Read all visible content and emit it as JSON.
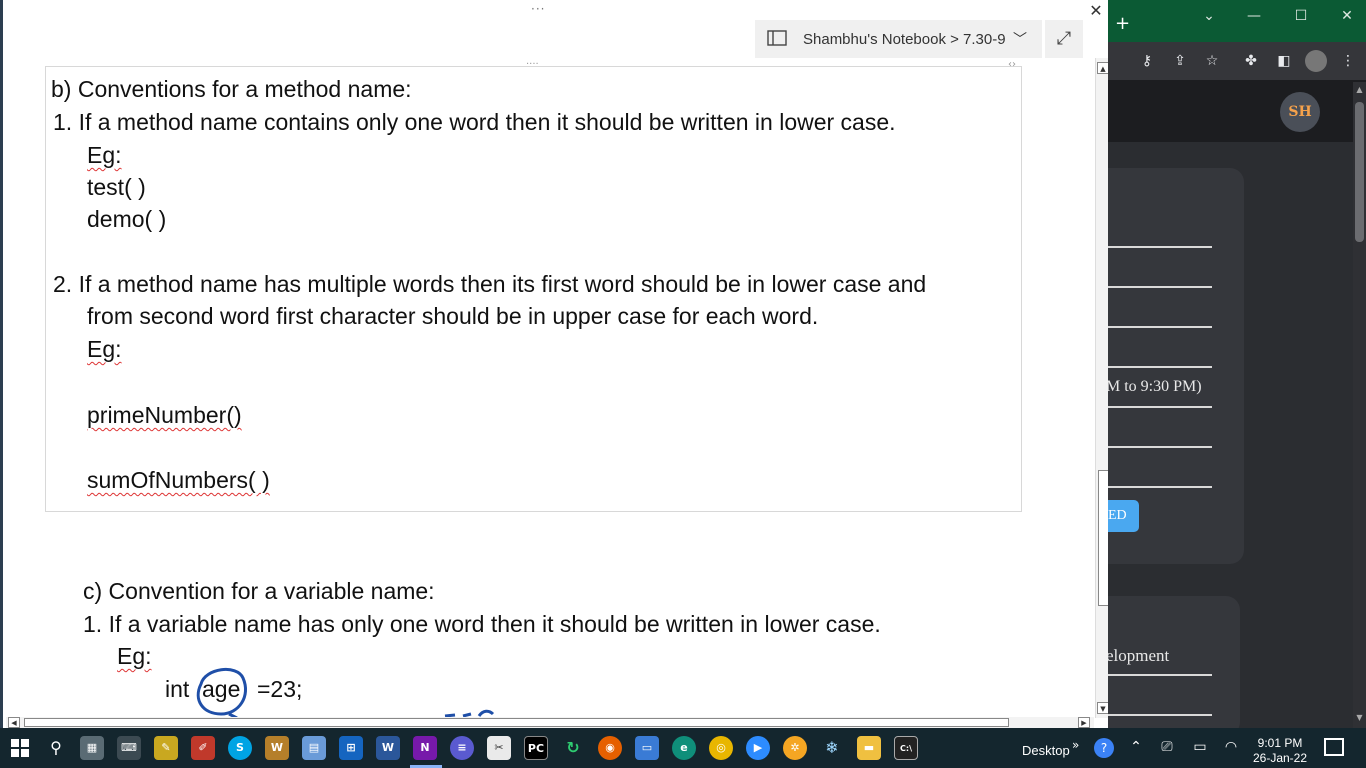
{
  "browser": {
    "avatar_initials": "SH",
    "time_text": "M to 9:30 PM)",
    "button_text": "ED",
    "dev_text": "elopment",
    "title_bar_color": "#0b5a34",
    "accent": "#4aa8f0"
  },
  "onenote": {
    "breadcrumb": "Shambhu's Notebook > 7.30-9",
    "section_b": {
      "heading": "b)  Conventions for a method name:",
      "rule1": "1.  If a method name contains only one word then it should be written in lower case.",
      "rule1_eg": "Eg:",
      "rule1_ex1": "test( )",
      "rule1_ex2": "demo( )",
      "rule2_line1": "2.  If a method name has multiple words then its first word should be in lower case and",
      "rule2_line2": "from second word first character should be in upper case for each word.",
      "rule2_eg": "Eg:",
      "rule2_ex1": "primeNumber()",
      "rule2_ex2": "sumOfNumbers( )"
    },
    "section_c": {
      "heading": "c)  Convention for a variable name:",
      "rule1": "1.  If a variable name has only one word then it should be written in lower case.",
      "rule1_eg": "Eg:",
      "code_int": "int",
      "code_age": "age",
      "code_rest": "=23;"
    }
  },
  "taskbar": {
    "desktop_label": "Desktop",
    "time": "9:01 PM",
    "date": "26-Jan-22",
    "apps": [
      "search-icon",
      "calculator-icon",
      "keyboard-icon",
      "sticky-notes-icon",
      "paint-icon",
      "skype-icon",
      "word-icon",
      "notepad-icon",
      "store-icon",
      "word2-icon",
      "onenote-icon",
      "menu-icon",
      "snipping-icon",
      "pycharm-icon",
      "sync-icon",
      "firefox-icon",
      "monitor-icon",
      "edge-icon",
      "chrome-icon",
      "zoom-icon",
      "settings-icon",
      "snowflake-icon",
      "file-explorer-icon",
      "cmd-icon"
    ]
  }
}
